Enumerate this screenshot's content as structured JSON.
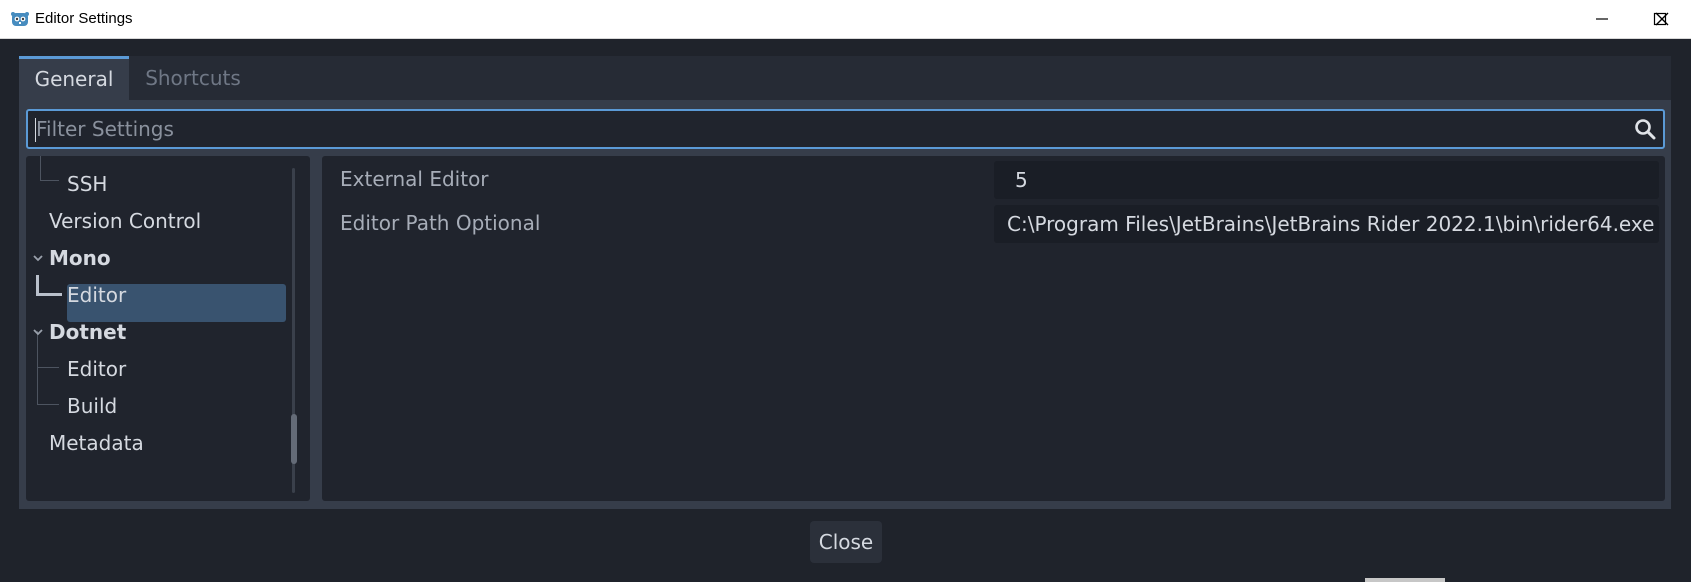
{
  "window": {
    "title": "Editor Settings"
  },
  "tabs": [
    {
      "label": "General",
      "active": true
    },
    {
      "label": "Shortcuts",
      "active": false
    }
  ],
  "filter": {
    "placeholder": "Filter Settings",
    "value": ""
  },
  "tree": {
    "items": [
      {
        "label": "SSH",
        "level": 2,
        "bold": false,
        "selected": false
      },
      {
        "label": "Version Control",
        "level": 1,
        "bold": false,
        "selected": false
      },
      {
        "label": "Mono",
        "level": 0,
        "bold": true,
        "expanded": true
      },
      {
        "label": "Editor",
        "level": 1,
        "bold": false,
        "selected": true
      },
      {
        "label": "Dotnet",
        "level": 0,
        "bold": true,
        "expanded": true
      },
      {
        "label": "Editor",
        "level": 1,
        "bold": false,
        "selected": false
      },
      {
        "label": "Build",
        "level": 1,
        "bold": false,
        "selected": false
      },
      {
        "label": "Metadata",
        "level": 1,
        "bold": false,
        "selected": false
      }
    ]
  },
  "inspector": {
    "properties": [
      {
        "label": "External Editor",
        "value": "5"
      },
      {
        "label": "Editor Path Optional",
        "value": "C:\\Program Files\\JetBrains\\JetBrains Rider 2022.1\\bin\\rider64.exe"
      }
    ]
  },
  "footer": {
    "close_label": "Close"
  },
  "colors": {
    "accent": "#5b9ad6",
    "selection": "#39536f",
    "panel": "#20242d",
    "background": "#1f232b"
  }
}
